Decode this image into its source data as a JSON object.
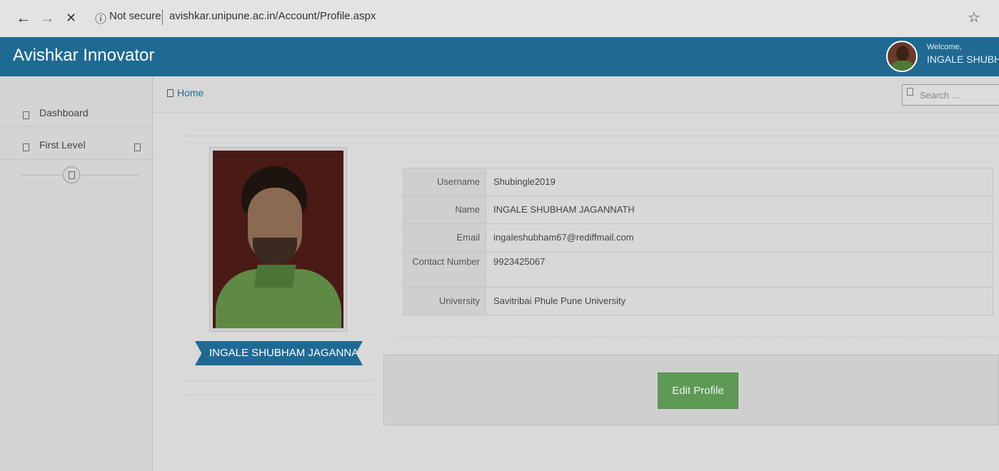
{
  "browser": {
    "back_icon": "←",
    "forward_icon": "→",
    "close_icon": "✕",
    "info_icon": "ⓘ",
    "security_label": "Not secure",
    "url": "avishkar.unipune.ac.in/Account/Profile.aspx",
    "star_icon": "☆"
  },
  "header": {
    "brand": "Avishkar Innovator",
    "welcome": "Welcome,",
    "user_name": "INGALE SHUBHAM"
  },
  "breadcrumb": {
    "home": "Home"
  },
  "search": {
    "placeholder": "Search ..."
  },
  "sidebar": {
    "items": [
      {
        "label": "Dashboard"
      },
      {
        "label": "First Level"
      }
    ]
  },
  "profile": {
    "display_name": "INGALE SHUBHAM JAGANNATH",
    "fields": [
      {
        "key": "Username",
        "value": "Shubingle2019"
      },
      {
        "key": "Name",
        "value": "INGALE SHUBHAM JAGANNATH"
      },
      {
        "key": "Email",
        "value": "ingaleshubham67@rediffmail.com"
      },
      {
        "key": "Contact Number",
        "value": "9923425067"
      },
      {
        "key": "University",
        "value": "Savitribai Phule Pune University"
      }
    ],
    "edit_label": "Edit Profile"
  },
  "colors": {
    "brand_blue": "#1f6a93",
    "button_green": "#5d9b55"
  }
}
